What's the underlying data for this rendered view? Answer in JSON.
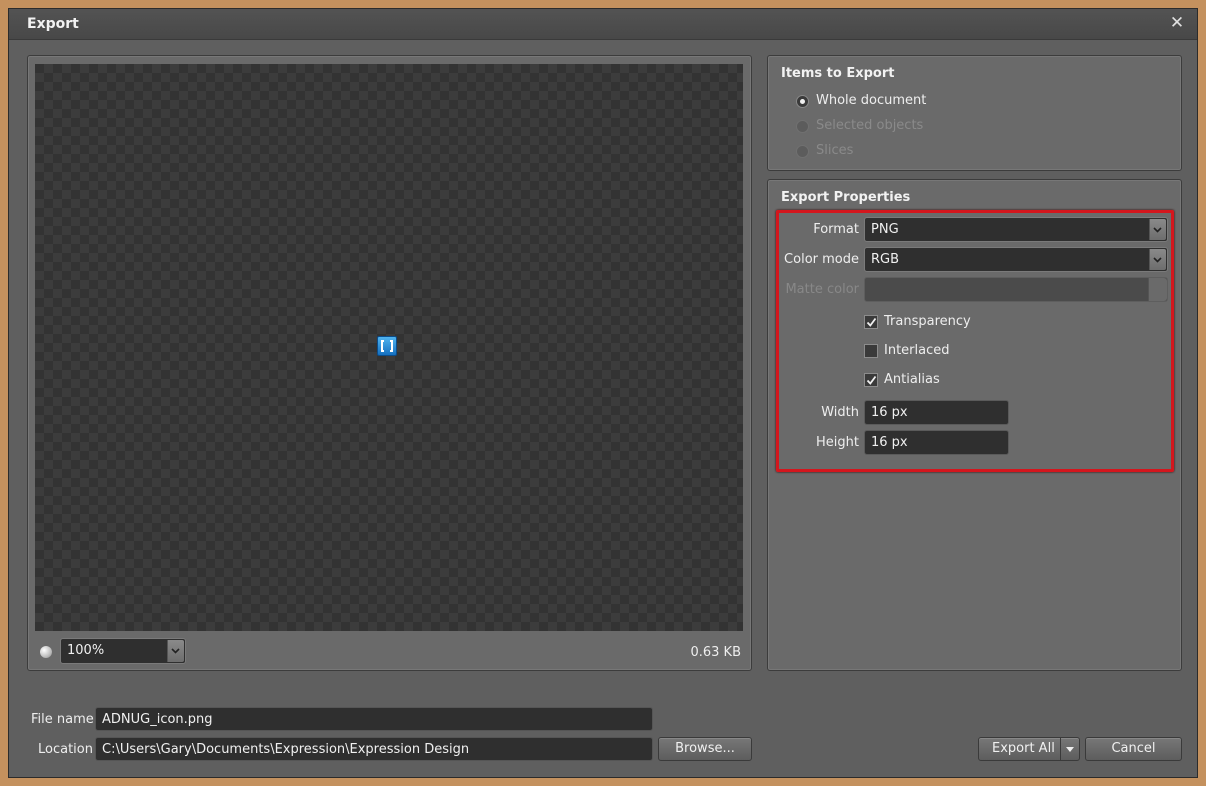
{
  "window": {
    "title": "Export"
  },
  "preview": {
    "zoom": "100%",
    "file_size": "0.63 KB"
  },
  "items_to_export": {
    "title": "Items to Export",
    "options": [
      {
        "label": "Whole document",
        "checked": true,
        "enabled": true
      },
      {
        "label": "Selected objects",
        "checked": false,
        "enabled": false
      },
      {
        "label": "Slices",
        "checked": false,
        "enabled": false
      }
    ]
  },
  "export_properties": {
    "title": "Export Properties",
    "format_label": "Format",
    "format_value": "PNG",
    "color_mode_label": "Color mode",
    "color_mode_value": "RGB",
    "matte_color_label": "Matte color",
    "transparency_label": "Transparency",
    "transparency_checked": true,
    "interlaced_label": "Interlaced",
    "interlaced_checked": false,
    "antialias_label": "Antialias",
    "antialias_checked": true,
    "width_label": "Width",
    "width_value": "16 px",
    "height_label": "Height",
    "height_value": "16 px",
    "highlight_color": "#d4161d"
  },
  "file": {
    "name_label": "File name",
    "name_value": "ADNUG_icon.png",
    "location_label": "Location",
    "location_value": "C:\\Users\\Gary\\Documents\\Expression\\Expression Design",
    "browse_label": "Browse..."
  },
  "buttons": {
    "export_all": "Export All",
    "cancel": "Cancel"
  }
}
